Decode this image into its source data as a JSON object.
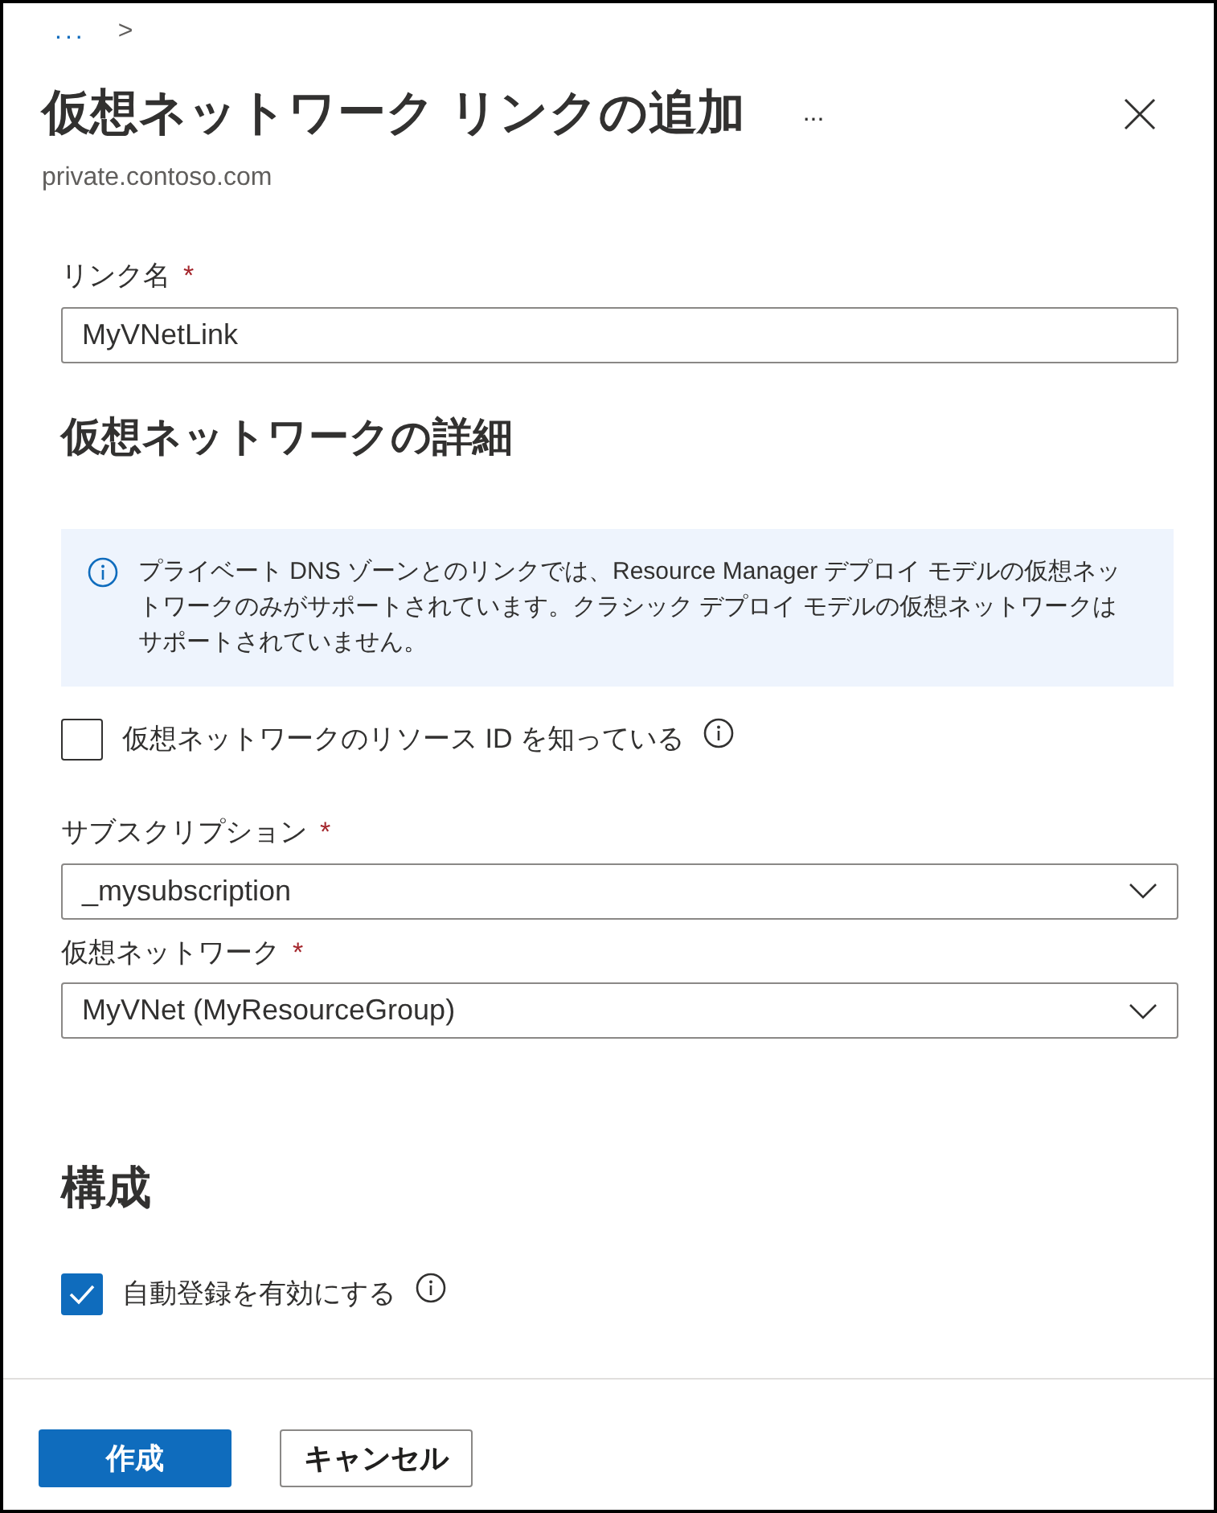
{
  "breadcrumb": {
    "ellipsis": "...",
    "separator": ">"
  },
  "header": {
    "title": "仮想ネットワーク リンクの追加",
    "more": "...",
    "subtitle": "private.contoso.com"
  },
  "link_name": {
    "label": "リンク名",
    "required_mark": "*",
    "value": "MyVNetLink"
  },
  "details": {
    "heading": "仮想ネットワークの詳細",
    "info": "プライベート DNS ゾーンとのリンクでは、Resource Manager デプロイ モデルの仮想ネットワークのみがサポートされています。クラシック デプロイ モデルの仮想ネットワークはサポートされていません。",
    "know_id": {
      "label": "仮想ネットワークのリソース ID を知っている",
      "checked": false
    },
    "selects": [
      {
        "label": "サブスクリプション",
        "required_mark": "*",
        "value": "_mysubscription"
      },
      {
        "label": "仮想ネットワーク",
        "required_mark": "*",
        "value": "MyVNet (MyResourceGroup)"
      }
    ]
  },
  "config": {
    "heading": "構成",
    "auto_registration": {
      "label": "自動登録を有効にする",
      "checked": true
    }
  },
  "buttons": [
    {
      "label": "作成",
      "kind": "primary"
    },
    {
      "label": "キャンセル",
      "kind": "secondary"
    }
  ]
}
